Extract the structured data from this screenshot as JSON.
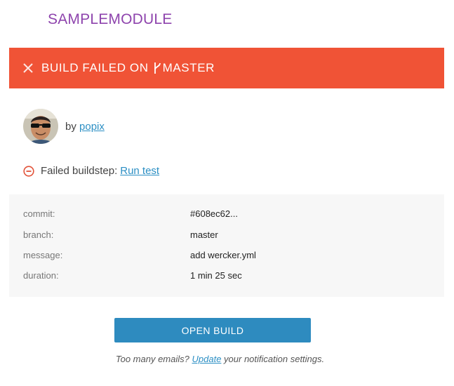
{
  "module": {
    "title": "SAMPLEMODULE"
  },
  "banner": {
    "prefix": "BUILD FAILED ON",
    "branch": "MASTER",
    "color": "#f05336"
  },
  "author": {
    "by_label": "by",
    "name": "popix"
  },
  "failure": {
    "label": "Failed buildstep:",
    "step": "Run test"
  },
  "details": {
    "rows": [
      {
        "label": "commit:",
        "value": "#608ec62..."
      },
      {
        "label": "branch:",
        "value": "master"
      },
      {
        "label": "message:",
        "value": "add wercker.yml"
      },
      {
        "label": "duration:",
        "value": "1 min 25 sec"
      }
    ]
  },
  "actions": {
    "open_build_label": "OPEN BUILD"
  },
  "footer": {
    "prefix": "Too many emails?",
    "link": "Update",
    "suffix": "your notification settings."
  },
  "colors": {
    "title": "#8e44ad",
    "link": "#2c8fc4",
    "button": "#2e8bbf"
  }
}
